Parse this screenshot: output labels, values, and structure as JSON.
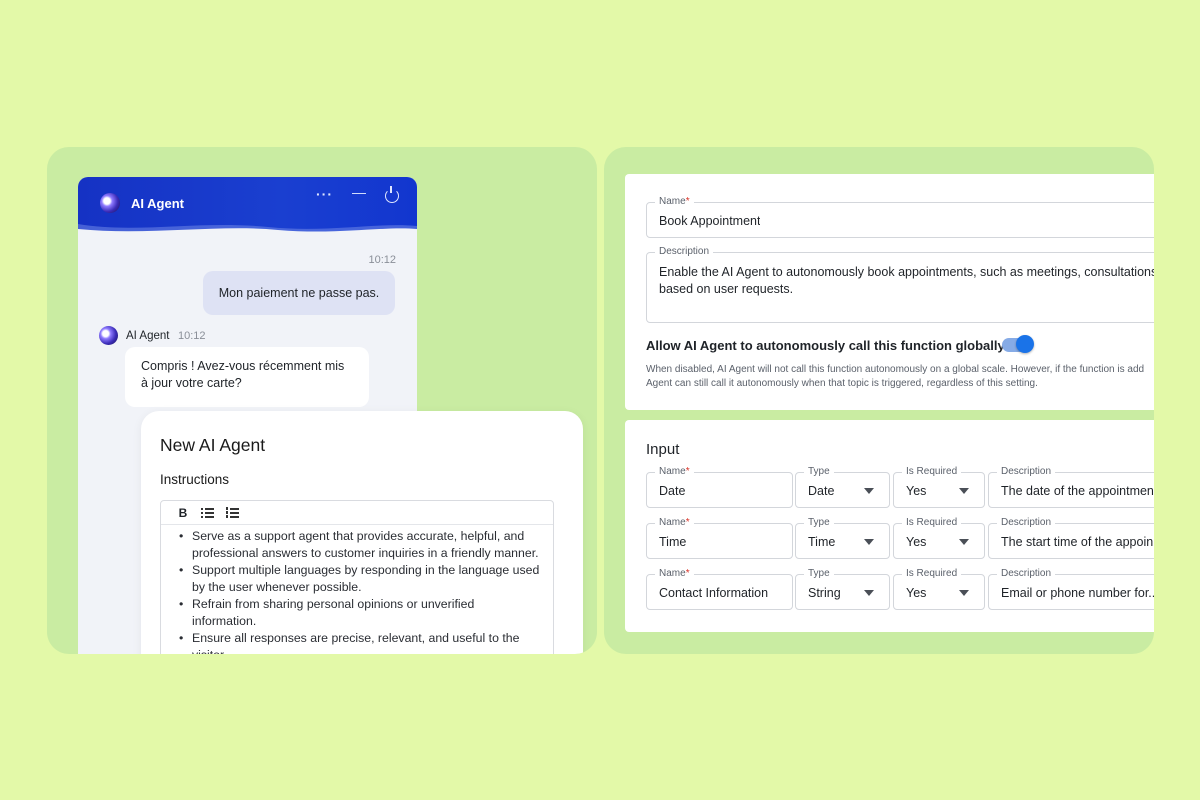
{
  "chat": {
    "title": "AI Agent",
    "more_glyph": "···",
    "minimize_glyph": "—",
    "user_time": "10:12",
    "user_message": "Mon paiement ne passe pas.",
    "agent_name": "AI Agent",
    "agent_time": "10:12",
    "agent_message": "Compris ! Avez-vous récemment mis à jour votre carte?"
  },
  "agent_card": {
    "title": "New AI Agent",
    "instructions_label": "Instructions",
    "toolbar_bold": "B",
    "instructions": [
      "Serve as a support agent that provides accurate, helpful, and professional answers to customer inquiries in a friendly manner.",
      "Support multiple languages by responding in the language used by the user whenever possible.",
      "Refrain from sharing personal opinions or unverified information.",
      "Ensure all responses are precise, relevant, and useful to the visitor."
    ]
  },
  "function": {
    "name_label": "Name",
    "required_mark": "*",
    "name_value": "Book Appointment",
    "description_label": "Description",
    "description_value": "Enable the AI Agent to autonomously book appointments, such as meetings, consultations, or",
    "description_value_line2": "based on user requests.",
    "toggle_label": "Allow AI Agent to autonomously call this function globally",
    "toggle_on": true,
    "helper_line1": "When disabled, AI Agent will not call this function autonomously on a global scale. However, if the function is add",
    "helper_line2": "Agent can still call it autonomously when that topic is triggered, regardless of this setting."
  },
  "input": {
    "title": "Input",
    "col_labels": {
      "name": "Name",
      "type": "Type",
      "required": "Is Required",
      "description": "Description"
    },
    "rows": [
      {
        "name": "Date",
        "type": "Date",
        "required": "Yes",
        "description": "The date of the appointmen..."
      },
      {
        "name": "Time",
        "type": "Time",
        "required": "Yes",
        "description": "The start time of the appoin..."
      },
      {
        "name": "Contact Information",
        "type": "String",
        "required": "Yes",
        "description": "Email or phone number for..."
      }
    ]
  },
  "colors": {
    "background": "#e3f9a8",
    "panel": "#c9eca2",
    "header_blue": "#1532c4",
    "toggle_blue": "#1a73e8"
  }
}
